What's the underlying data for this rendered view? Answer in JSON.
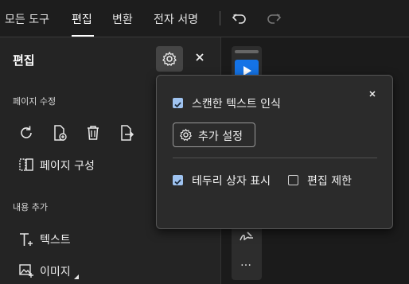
{
  "tabs": [
    "모든 도구",
    "편집",
    "변환",
    "전자 서명"
  ],
  "active_tab": "편집",
  "panel": {
    "title": "편집",
    "section_page": "페이지 수정",
    "page_arrange_label": "페이지 구성",
    "section_content": "내용 추가",
    "text_label": "텍스트",
    "image_label": "이미지"
  },
  "popup": {
    "ocr_label": "스캔한 텍스트 인식",
    "ocr_checked": true,
    "more_settings_label": "추가 설정",
    "bbox_label": "테두리 상자 표시",
    "bbox_checked": true,
    "restrict_label": "편집 제한",
    "restrict_checked": false
  },
  "toolbar_more": "…",
  "colors": {
    "accent": "#1473e6",
    "checkbox": "#9fc3f0"
  }
}
